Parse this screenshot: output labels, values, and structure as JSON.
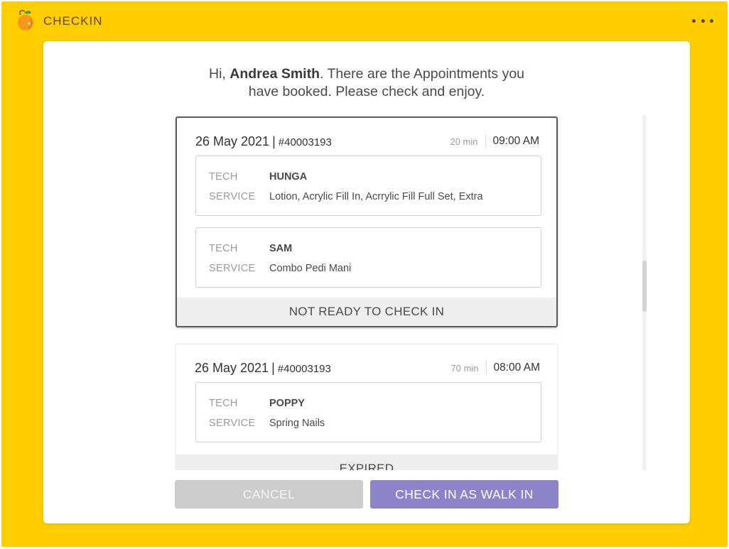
{
  "app": {
    "title": "CHECKIN",
    "logo_icon": "orange-fruit-logo",
    "menu_icon": "more-horizontal-icon"
  },
  "colors": {
    "background": "#ffcd00",
    "primary_button": "#8b84c9",
    "disabled_button": "#cccccc",
    "status_bar": "#eeeeee"
  },
  "greeting": {
    "prefix": "Hi, ",
    "name": "Andrea Smith",
    "suffix": ". There are the Appointments you",
    "line2": "have booked. Please check and enjoy."
  },
  "labels": {
    "tech": "TECH",
    "service": "SERVICE",
    "separator": "|"
  },
  "appointments": [
    {
      "date": "26 May 2021",
      "id": "#40003193",
      "duration": "20 min",
      "time": "09:00 AM",
      "selected": true,
      "services": [
        {
          "tech": "HUNGA",
          "service": "Lotion, Acrylic Fill In, Acrrylic Fill Full Set, Extra"
        },
        {
          "tech": "SAM",
          "service": "Combo Pedi Mani"
        }
      ],
      "status": "NOT READY TO CHECK IN"
    },
    {
      "date": "26 May 2021",
      "id": "#40003193",
      "duration": "70 min",
      "time": "08:00 AM",
      "selected": false,
      "services": [
        {
          "tech": "POPPY",
          "service": "Spring Nails"
        }
      ],
      "status": "EXPIRED"
    }
  ],
  "buttons": {
    "cancel": "CANCEL",
    "walk_in": "CHECK IN AS WALK IN"
  }
}
